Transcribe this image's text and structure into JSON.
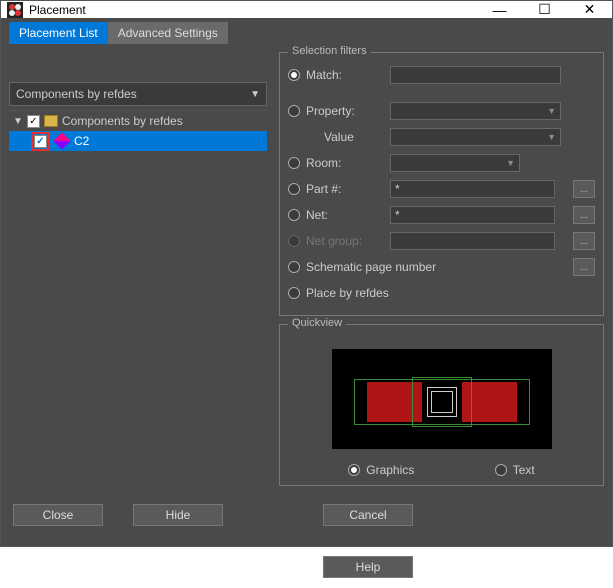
{
  "window": {
    "title": "Placement"
  },
  "tabs": {
    "placement_list": "Placement List",
    "advanced": "Advanced Settings",
    "active": "placement_list"
  },
  "left": {
    "dropdown_label": "Components by refdes",
    "root_label": "Components by refdes",
    "child_label": "C2"
  },
  "filters": {
    "legend": "Selection filters",
    "match": {
      "label": "Match:",
      "value": ""
    },
    "property": {
      "label": "Property:",
      "value": ""
    },
    "property_value": {
      "label": "Value",
      "value": ""
    },
    "room": {
      "label": "Room:"
    },
    "part": {
      "label": "Part #:",
      "value": "*"
    },
    "net": {
      "label": "Net:",
      "value": "*"
    },
    "netgroup": {
      "label": "Net group:",
      "value": ""
    },
    "schematic": {
      "label": "Schematic page number"
    },
    "place_by_refdes": {
      "label": "Place by refdes"
    },
    "selected": "match",
    "more_label": "..."
  },
  "quickview": {
    "legend": "Quickview",
    "graphics": "Graphics",
    "text": "Text",
    "selected": "graphics"
  },
  "footer": {
    "close": "Close",
    "hide": "Hide",
    "cancel": "Cancel",
    "help": "Help"
  }
}
